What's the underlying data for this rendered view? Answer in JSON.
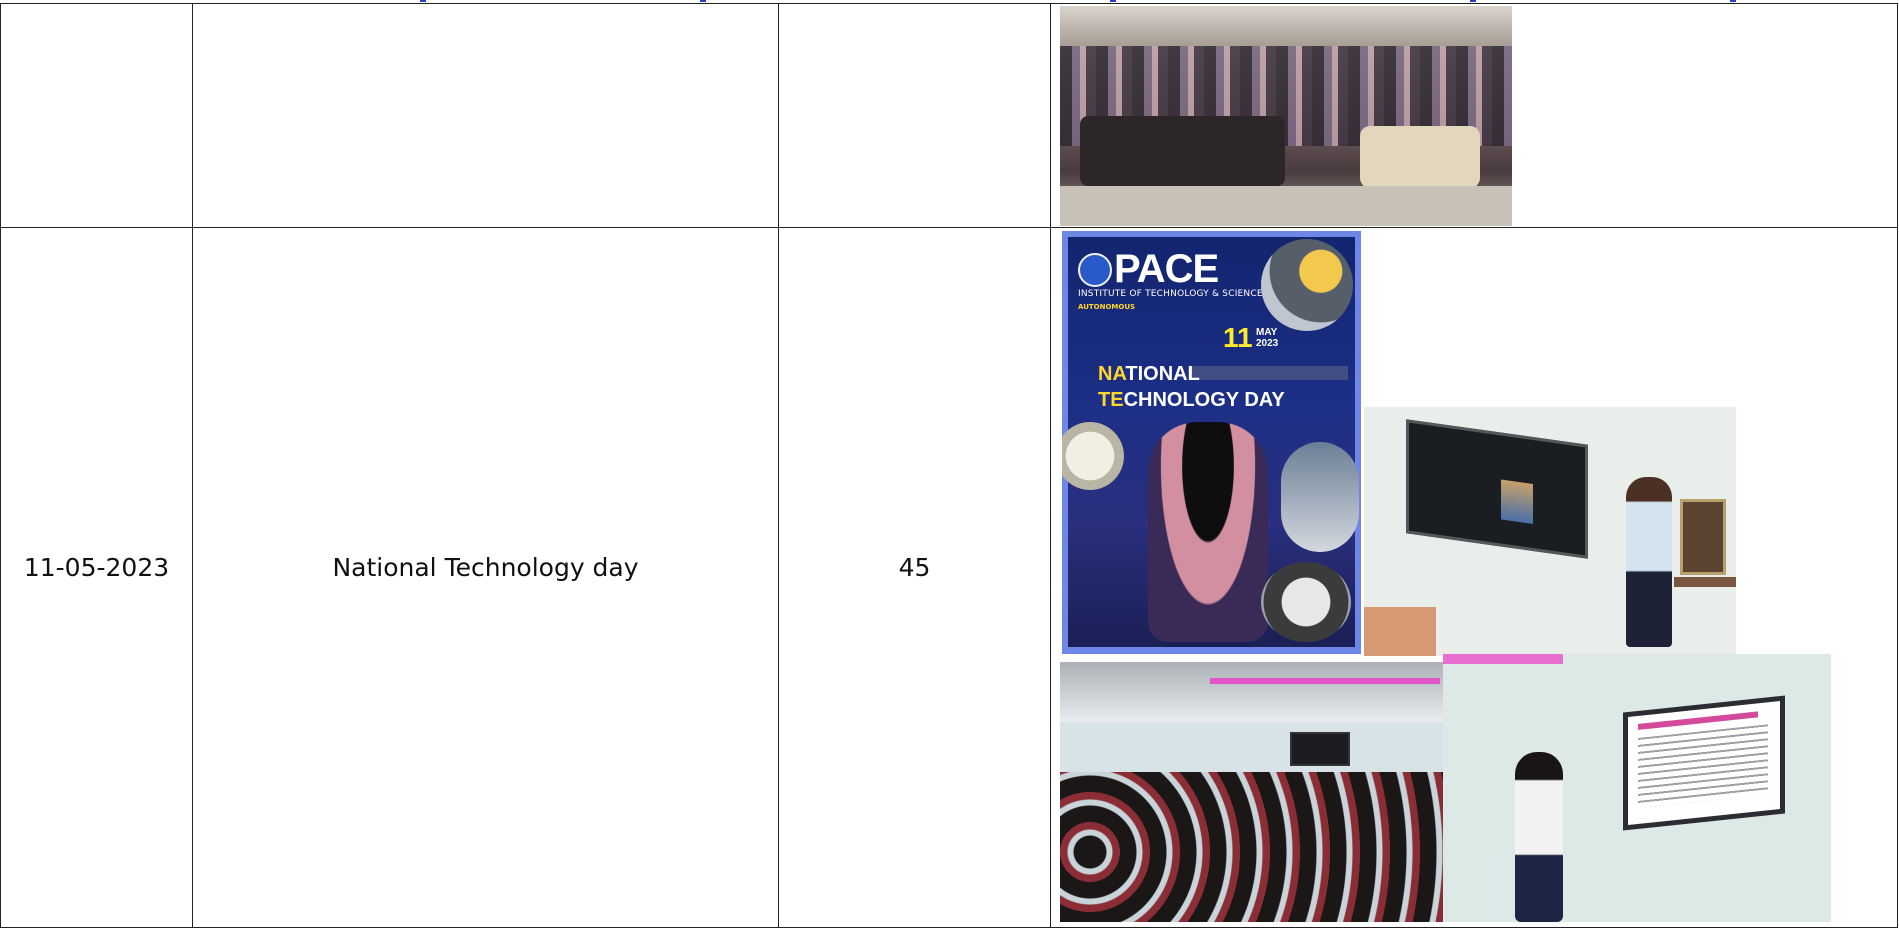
{
  "rows": [
    {
      "date": "",
      "event": "",
      "participants": "",
      "photos": [
        "auditorium-audience-photo"
      ]
    },
    {
      "date": "11-05-2023",
      "event": "National Technology day",
      "participants": "45",
      "poster": {
        "brand": "PACE",
        "institute": "INSTITUTE OF TECHNOLOGY & SCIENCES",
        "badge": "AUTONOMOUS",
        "day": "11",
        "month": "MAY",
        "year": "2023",
        "title_line1_highlight": "NA",
        "title_line1_rest": "TIONAL",
        "title_line2_highlight": "TE",
        "title_line2_rest": "CHNOLOGY DAY"
      },
      "photos": [
        "event-poster",
        "presenter-with-screen-photo",
        "student-audience-photo",
        "student-presenter-photo"
      ]
    }
  ],
  "colors": {
    "border": "#222222",
    "text": "#111111",
    "poster_accent": "#ffd62a",
    "poster_bg": "#13246f"
  }
}
